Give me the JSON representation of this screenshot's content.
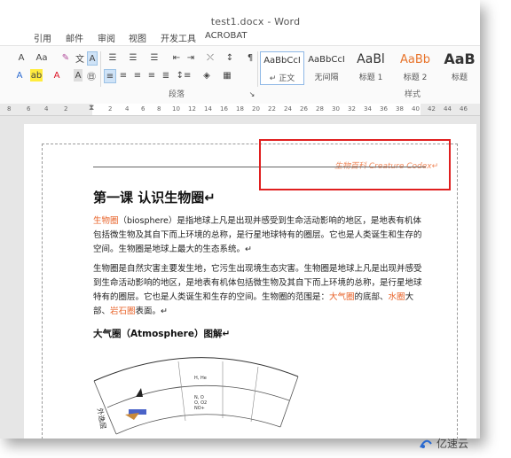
{
  "window": {
    "title": "test1.docx - Word"
  },
  "menu": [
    "引用",
    "邮件",
    "审阅",
    "视图",
    "开发工具",
    "ACROBAT"
  ],
  "ribbon": {
    "font_size_btn": "Aa",
    "group_paragraph": "段落",
    "group_styles": "样式",
    "styles": [
      {
        "sample": "AaBbCcI",
        "name": "↵ 正文"
      },
      {
        "sample": "AaBbCcI",
        "name": "无间隔"
      },
      {
        "sample": "AaBl",
        "name": "标题 1"
      },
      {
        "sample": "AaBb",
        "name": "标题 2"
      },
      {
        "sample": "AaB",
        "name": "标题"
      }
    ]
  },
  "ruler": [
    "8",
    "6",
    "4",
    "2",
    "2",
    "4",
    "6",
    "8",
    "10",
    "12",
    "14",
    "16",
    "18",
    "20",
    "22",
    "24",
    "26",
    "28",
    "30",
    "32",
    "34",
    "36",
    "38",
    "40",
    "42",
    "44",
    "46"
  ],
  "doc": {
    "header": "生物百科 Creature Codex↵",
    "title": "第一课  认识生物圈↵",
    "p1_pre": "",
    "p1_hl": "生物圈",
    "p1_rest": "（biosphere）是指地球上凡是出现并感受到生命活动影响的地区，是地表有机体包括微生物及其自下而上环境的总称，是行星地球特有的圈层。它也是人类诞生和生存的空间。生物圈是地球上最大的生态系统。↵",
    "p2_main": "生物圈是自然灾害主要发生地，它污生出现境生态灾害。生物圈是地球上凡是出现并感受到生命活动影响的地区，是地表有机体包括微生物及其自下而上环境的总称，是行星地球特有的圈层。它也是人类诞生和生存的空间。生物圈的范围是：",
    "p2_hl1": "大气圈",
    "p2_mid1": "的底部、",
    "p2_hl2": "水圈",
    "p2_mid2": "大部、",
    "p2_hl3": "岩石圈",
    "p2_end": "表面。↵",
    "h2": "大气圈（Atmosphere）图解↵",
    "diagram_left_label": "外逸层",
    "diagram_labels": [
      "H, He",
      "N, O",
      "O, O2",
      "NO+"
    ]
  },
  "watermark": "亿速云"
}
